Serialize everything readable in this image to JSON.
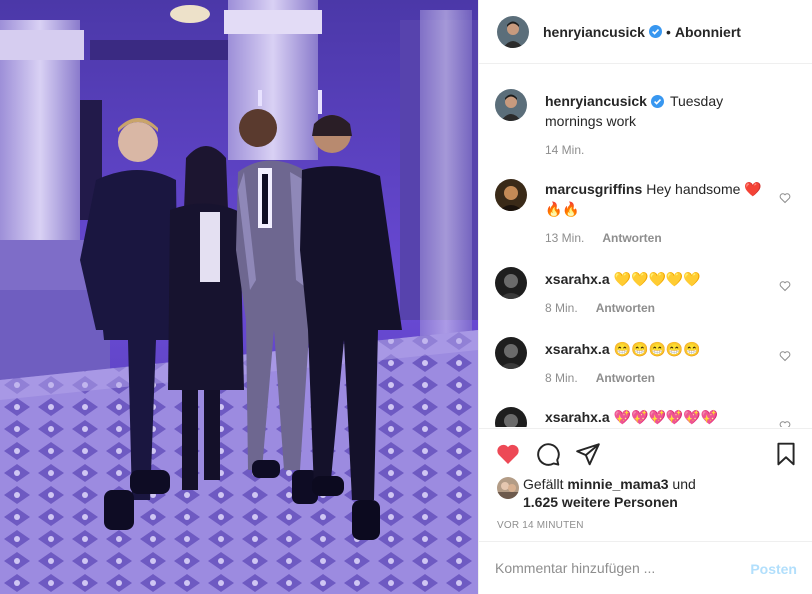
{
  "post": {
    "username": "henryiancusick",
    "follow_state": "Abonniert",
    "separator": "•",
    "caption": "Tuesday mornings work",
    "caption_age": "14 Min."
  },
  "comments": [
    {
      "user": "marcusgriffins",
      "text": "Hey handsome ❤️ 🔥🔥",
      "age": "13 Min.",
      "reply": "Antworten"
    },
    {
      "user": "xsarahx.a",
      "text": "💛💛💛💛💛",
      "age": "8 Min.",
      "reply": "Antworten"
    },
    {
      "user": "xsarahx.a",
      "text": "😁😁😁😁😁",
      "age": "8 Min.",
      "reply": "Antworten"
    },
    {
      "user": "xsarahx.a",
      "text": "💖💖💖💖💖💖"
    }
  ],
  "likes": {
    "prefix": "Gefällt",
    "first_user": "minnie_mama3",
    "joiner": "und",
    "others": "1.625 weitere Personen"
  },
  "timestamp": "VOR 14 MINUTEN",
  "composer": {
    "placeholder": "Kommentar hinzufügen ...",
    "post_label": "Posten"
  },
  "colors": {
    "like_active": "#ed4956",
    "post_disabled": "#b2dffc",
    "verified_badge": "#3897f0",
    "photo_tint": "#5a3ac8"
  },
  "icons": {
    "like": "heart-icon",
    "comment": "speech-bubble-icon",
    "share": "paper-plane-icon",
    "save": "bookmark-icon",
    "verified": "verified-badge-icon"
  }
}
